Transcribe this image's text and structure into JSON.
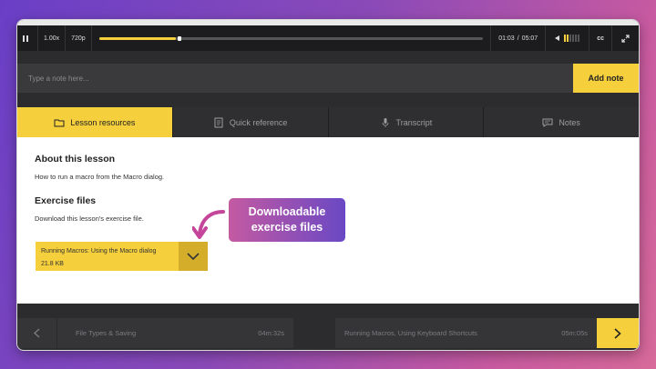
{
  "player": {
    "speed": "1.00x",
    "quality": "720p",
    "progress_fraction": 0.2,
    "time_current": "01:03",
    "time_separator": "/",
    "time_total": "05:07",
    "cc_label": "cc",
    "volume_level_bars": 2,
    "volume_total_bars": 6
  },
  "note": {
    "placeholder": "Type a note here...",
    "add_label": "Add note"
  },
  "tabs": [
    {
      "label": "Lesson resources",
      "icon": "folder-icon",
      "active": true
    },
    {
      "label": "Quick reference",
      "icon": "document-icon",
      "active": false
    },
    {
      "label": "Transcript",
      "icon": "microphone-icon",
      "active": false
    },
    {
      "label": "Notes",
      "icon": "comment-icon",
      "active": false
    }
  ],
  "content": {
    "about_heading": "About this lesson",
    "about_text": "How to run a macro from the Macro dialog.",
    "exercise_heading": "Exercise files",
    "exercise_text": "Download this lesson's exercise file.",
    "file_name": "Running Macros: Using the Macro dialog",
    "file_size": "21.8 KB"
  },
  "callout": {
    "line1": "Downloadable",
    "line2": "exercise files"
  },
  "bottom_nav": {
    "prev_title": "File Types & Saving",
    "prev_duration": "04m:32s",
    "next_title": "Running Macros, Using Keyboard Shortcuts",
    "next_duration": "05m:05s"
  },
  "colors": {
    "accent": "#f5cf3c",
    "accent_dark": "#d4ae2a",
    "callout_start": "#c45aa2",
    "callout_end": "#6a48c4",
    "arrow": "#c4459a"
  }
}
